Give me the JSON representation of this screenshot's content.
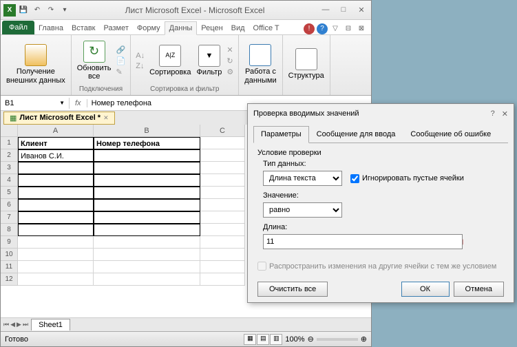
{
  "titlebar": {
    "title": "Лист Microsoft Excel - Microsoft Excel"
  },
  "tabs": {
    "file": "Файл",
    "home": "Главна",
    "insert": "Вставк",
    "layout": "Размет",
    "formula": "Форму",
    "data": "Данны",
    "review": "Рецен",
    "view": "Вид",
    "office": "Office T"
  },
  "ribbon": {
    "g1": {
      "btn": "Получение\nвнешних данных",
      "label": ""
    },
    "g2": {
      "btn": "Обновить\nвсе",
      "label": "Подключения"
    },
    "g3": {
      "btn": "Сортировка",
      "label": "Сортировка и фильтр"
    },
    "g4": {
      "btn": "Фильтр"
    },
    "g5": {
      "btn": "Работа с\nданными",
      "label": ""
    },
    "g6": {
      "btn": "Структура",
      "label": ""
    }
  },
  "namebox": "B1",
  "formula": "Номер телефона",
  "doctab": "Лист Microsoft Excel *",
  "cols": [
    "A",
    "B",
    "C"
  ],
  "cells": {
    "A1": "Клиент",
    "B1": "Номер телефона",
    "A2": "Иванов С.И."
  },
  "sheet": "Sheet1",
  "status": "Готово",
  "zoom": "100%",
  "dialog": {
    "title": "Проверка вводимых значений",
    "tabs": {
      "params": "Параметры",
      "input": "Сообщение для ввода",
      "error": "Сообщение об ошибке"
    },
    "section": "Условие проверки",
    "f1": {
      "label": "Тип данных:",
      "value": "Длина текста"
    },
    "ignore": "Игнорировать пустые ячейки",
    "f2": {
      "label": "Значение:",
      "value": "равно"
    },
    "f3": {
      "label": "Длина:",
      "value": "11"
    },
    "propagate": "Распространить изменения на другие ячейки с тем же условием",
    "clear": "Очистить все",
    "ok": "ОК",
    "cancel": "Отмена"
  }
}
